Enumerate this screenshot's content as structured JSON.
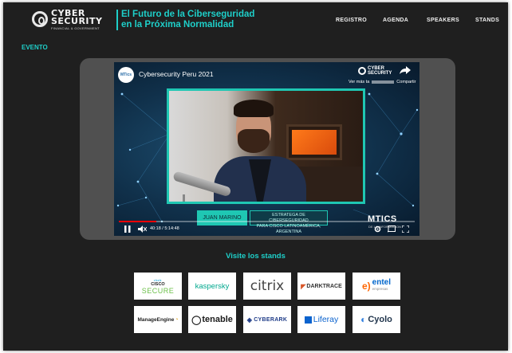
{
  "header": {
    "logo": {
      "word1": "CYBER",
      "word2": "SECURITY",
      "sub": "FINANCIAL & GOVERNMENT"
    },
    "tagline": {
      "line1": "El Futuro de la Ciberseguridad",
      "line2": "en la Próxima Normalidad"
    },
    "nav": [
      "REGISTRO",
      "AGENDA",
      "SPEAKERS",
      "STANDS"
    ]
  },
  "section_label": "EVENTO",
  "video": {
    "channel_avatar": "MTics",
    "title": "Cybersecurity Peru 2021",
    "watermark": {
      "line1": "CYBER",
      "line2": "SECURITY"
    },
    "more_label": "Ver más ta",
    "share_label": "Compartir",
    "speaker_name": "JUAN MARINO",
    "speaker_role_line1": "ESTRATEGA DE CIBERSEGURIDAD",
    "speaker_role_line2": "PARA CISCO LATINOAMÉRICA, ARGENTINA",
    "badge": "MTICS",
    "badge_sub": "DE LA INFORMACION",
    "time": "40:18 / 5:14:48",
    "progress": 0.128,
    "icons": [
      "play-icon",
      "mute-icon",
      "settings-icon",
      "cast-icon",
      "fullscreen-icon"
    ]
  },
  "stands": {
    "title": "Visite los stands",
    "row1": [
      {
        "lines": "ılıılı",
        "name": "CISCO",
        "secure": "SECURE"
      },
      {
        "label": "kaspersky",
        "color": "#00a88e"
      },
      {
        "label": "citrix",
        "color": "#444444"
      },
      {
        "label": "DARKTRACE",
        "color": "#333333"
      },
      {
        "label": "entel",
        "sub": "empresas",
        "color": "#0066cc"
      }
    ],
    "row2": [
      {
        "label": "ManageEngine",
        "color": "#222222"
      },
      {
        "label": "tenable",
        "color": "#1a1a1a"
      },
      {
        "label": "CYBERARK",
        "color": "#1f3c88"
      },
      {
        "label": "Liferay",
        "color": "#0b63ce"
      },
      {
        "label": "Cyolo",
        "color": "#22364d"
      }
    ]
  }
}
